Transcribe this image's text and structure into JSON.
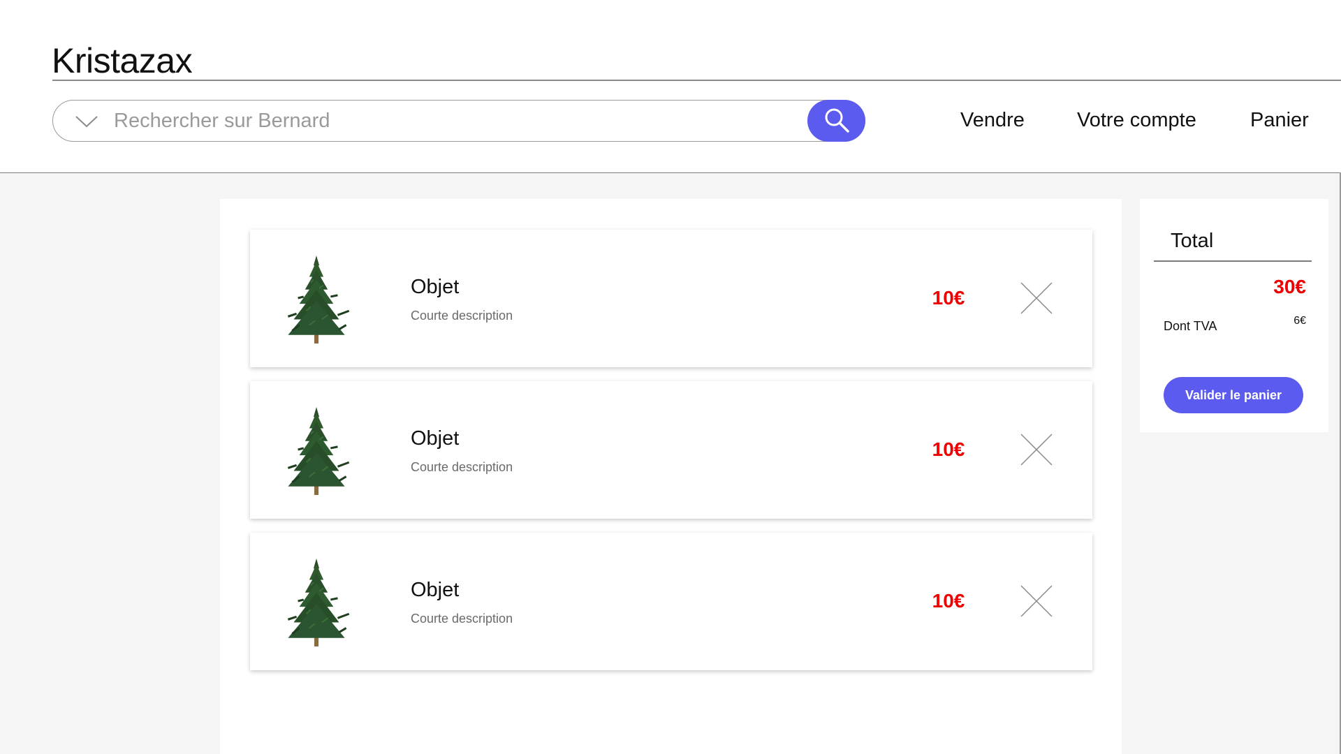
{
  "header": {
    "brand": "Kristazax",
    "search": {
      "placeholder": "Rechercher sur Bernard",
      "value": ""
    },
    "nav": {
      "sell": "Vendre",
      "account": "Votre compte",
      "cart": "Panier"
    }
  },
  "cart": {
    "items": [
      {
        "name": "Objet",
        "description": "Courte description",
        "price": "10€",
        "image": "christmas-tree-image"
      },
      {
        "name": "Objet",
        "description": "Courte description",
        "price": "10€",
        "image": "christmas-tree-image"
      },
      {
        "name": "Objet",
        "description": "Courte description",
        "price": "10€",
        "image": "christmas-tree-image"
      }
    ]
  },
  "summary": {
    "title": "Total",
    "total": "30€",
    "tva_label": "Dont TVA",
    "tva_value": "6€",
    "validate_label": "Valider le panier"
  },
  "icons": {
    "search_toggle": "chevron-down-icon",
    "search_submit": "search-icon",
    "remove_item": "close-icon"
  },
  "colors": {
    "accent": "#5b5bf0",
    "price": "#ee0000",
    "background": "#f5f5f5"
  }
}
